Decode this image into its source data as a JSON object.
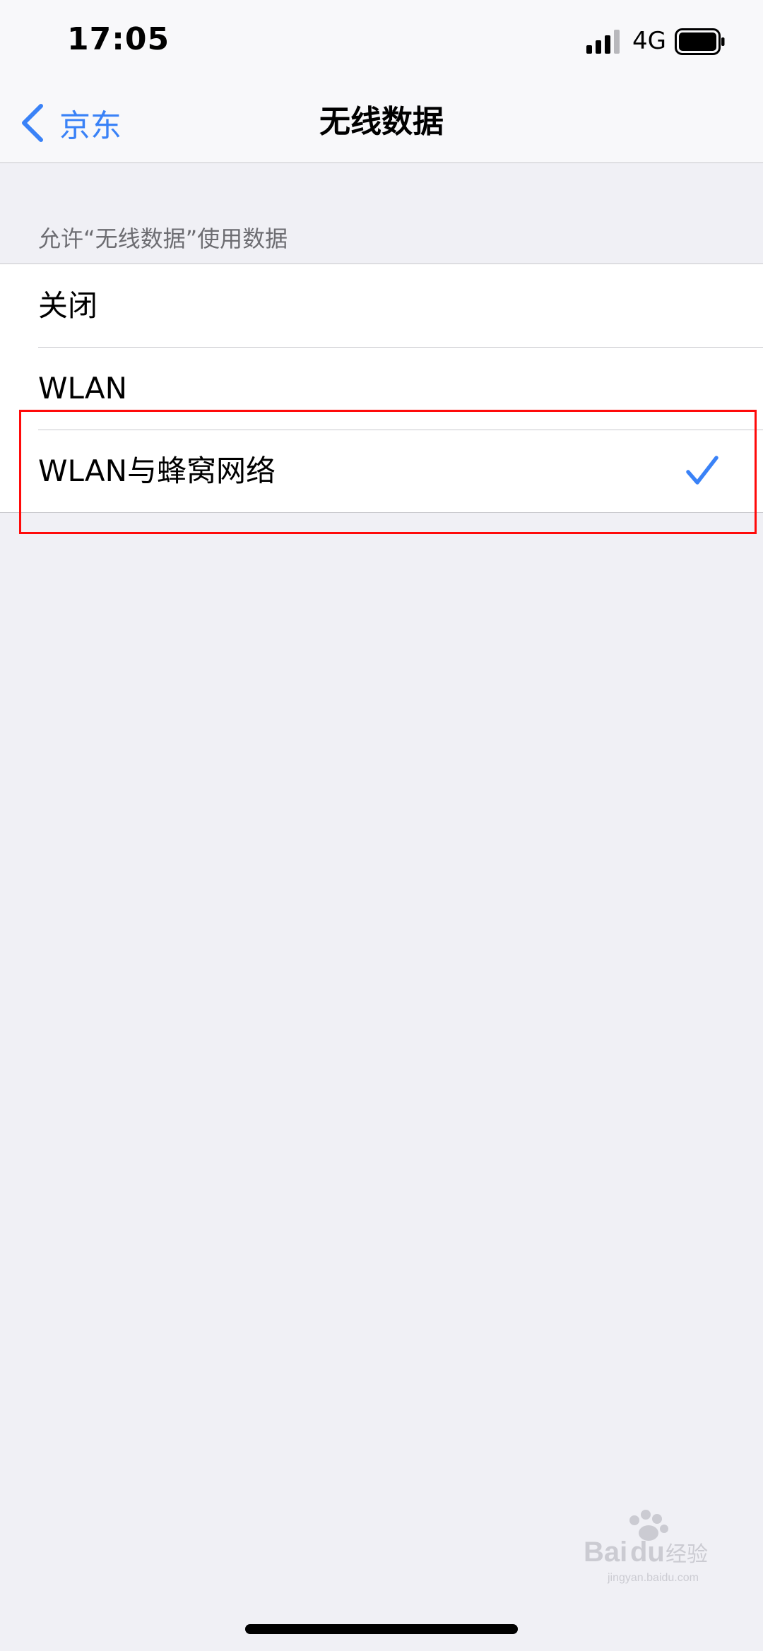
{
  "status_bar": {
    "time": "17:05",
    "network": "4G",
    "icons": [
      "signal-icon",
      "battery-icon"
    ]
  },
  "nav": {
    "back_label": "京东",
    "title": "无线数据",
    "icons": [
      "chevron-left-icon"
    ]
  },
  "section": {
    "header": "允许“无线数据”使用数据"
  },
  "options": [
    {
      "label": "关闭",
      "selected": false
    },
    {
      "label": "WLAN",
      "selected": false
    },
    {
      "label": "WLAN与蜂窝网络",
      "selected": true
    }
  ],
  "colors": {
    "accent": "#3a82f7",
    "background": "#f0f0f5",
    "highlight": "#ff0a0a",
    "separator": "#c8c8cc"
  },
  "watermark": {
    "text": "Baidu经验",
    "subtext": "jingyan.baidu.com"
  }
}
